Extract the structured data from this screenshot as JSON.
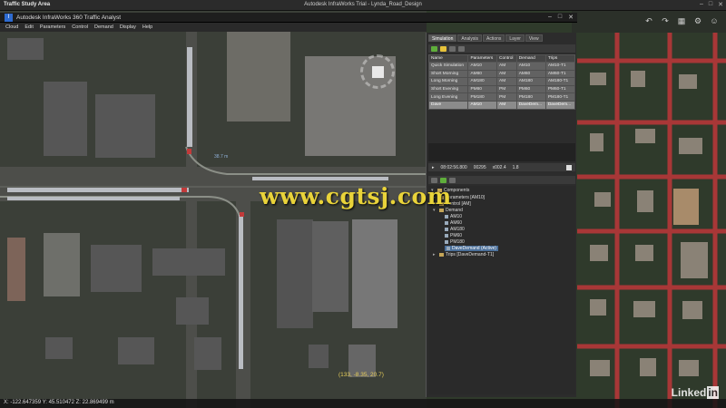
{
  "app": {
    "area_title": "Traffic Study Area",
    "window_title": "Autodesk InfraWorks Trial - Lynda_Road_Design"
  },
  "analyst_window": {
    "title": "Autodesk InfraWorks 360 Traffic Analyst",
    "menu": [
      "Cloud",
      "Edit",
      "Parameters",
      "Control",
      "Demand",
      "Display",
      "Help"
    ]
  },
  "panel": {
    "tabs": [
      "Simulation",
      "Analysis",
      "Actions",
      "Layer",
      "View"
    ],
    "active_tab": "Simulation",
    "table": {
      "headers": [
        "Name",
        "Parameters",
        "Control",
        "Demand",
        "Trips"
      ],
      "rows": [
        [
          "Quick Simulation",
          "AM10",
          "AM",
          "AM10",
          "AM10-T1"
        ],
        [
          "Short Morning",
          "AM60",
          "AM",
          "AM60",
          "AM60-T1"
        ],
        [
          "Long Morning",
          "AM180",
          "AM",
          "AM180",
          "AM180-T1"
        ],
        [
          "Short Evening",
          "PM60",
          "PM",
          "PM60",
          "PM60-T1"
        ],
        [
          "Long Evening",
          "PM180",
          "PM",
          "PM180",
          "PM180-T1"
        ],
        [
          "Dave",
          "AM10",
          "AM",
          "DaveDem...",
          "DaveDem..."
        ]
      ],
      "selected_row": 5
    },
    "time_row": {
      "time": "08:02:56.800",
      "count": "00295",
      "speed": "x002.4",
      "value": "1.8"
    },
    "components": {
      "root": "Components",
      "items": [
        {
          "label": "Parameters [AM10]",
          "level": 1
        },
        {
          "label": "Control [AM]",
          "level": 1
        },
        {
          "label": "Demand",
          "level": 1
        },
        {
          "label": "AM10",
          "level": 2
        },
        {
          "label": "AM60",
          "level": 2
        },
        {
          "label": "AM180",
          "level": 2
        },
        {
          "label": "PM60",
          "level": 2
        },
        {
          "label": "PM180",
          "level": 2
        },
        {
          "label": "DaveDemand (Active)",
          "level": 2
        },
        {
          "label": "Trips [DaveDemand-T1]",
          "level": 1
        }
      ]
    }
  },
  "map": {
    "street_label": "38.7 m",
    "coordinate_readout": "(133, -8.35, 20.7)",
    "status_coordinates": "X: -122.647359 Y: 45.510472 Z: 22.869499 m"
  },
  "watermark": "www.cgtsj.com",
  "brand": {
    "text": "Linked",
    "in": "in"
  },
  "colors": {
    "road_red": "#c23a3a",
    "watermark_yellow": "#e9d33a",
    "selected_row": "#8b8b8b"
  }
}
